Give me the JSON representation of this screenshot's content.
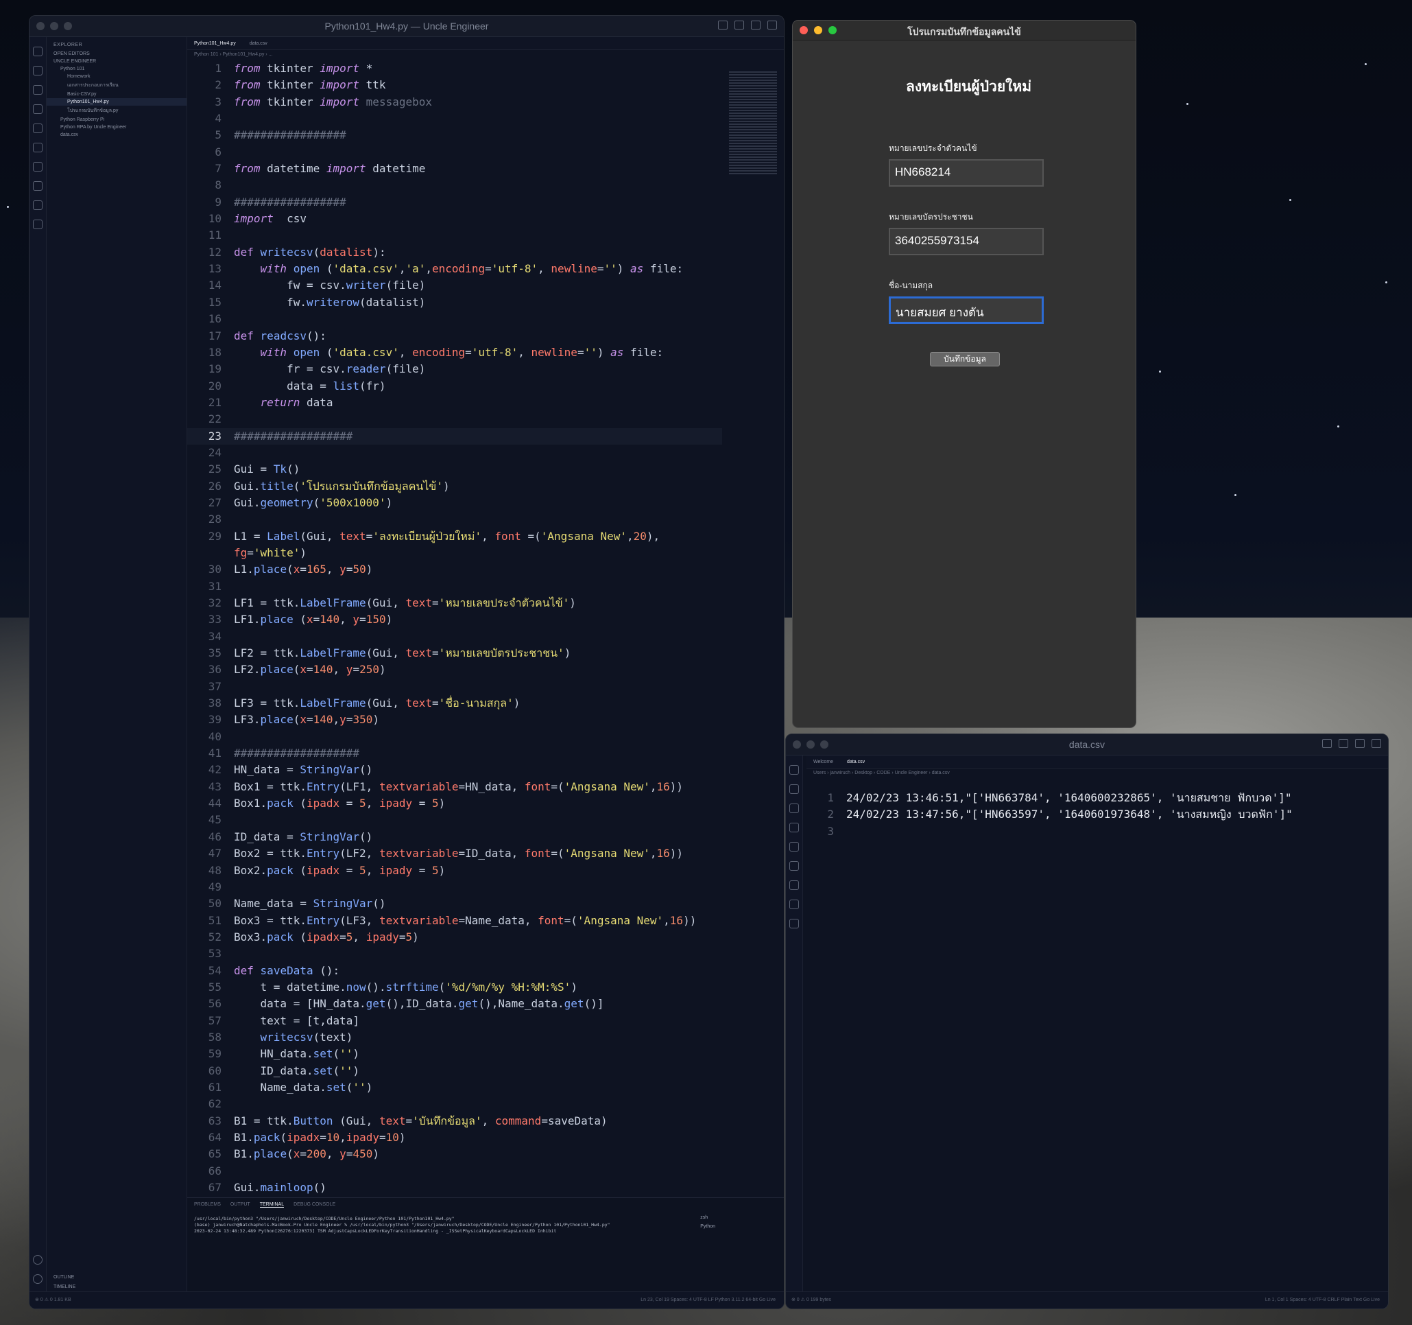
{
  "editor1": {
    "window_title": "Python101_Hw4.py — Uncle Engineer",
    "explorer_title": "EXPLORER",
    "sidebar": [
      {
        "label": "OPEN EDITORS"
      },
      {
        "label": "UNCLE ENGINEER"
      },
      {
        "label": "Python 101"
      },
      {
        "label": "Homework"
      },
      {
        "label": "เอกสารประกอบการเรียน"
      },
      {
        "label": "Basic-CSV.py"
      },
      {
        "label": "Python101_Hw4.py"
      },
      {
        "label": "โปรแกรมบันทึกข้อมูล.py"
      },
      {
        "label": "Python Raspberry Pi"
      },
      {
        "label": "Python RPA by Uncle Engineer"
      },
      {
        "label": "data.csv"
      }
    ],
    "outline": "OUTLINE",
    "timeline": "TIMELINE",
    "tabs": [
      {
        "label": "Python101_Hw4.py"
      },
      {
        "label": "data.csv"
      }
    ],
    "breadcrumb": "Python 101 › Python101_Hw4.py › ...",
    "panel_tabs": [
      "PROBLEMS",
      "OUTPUT",
      "TERMINAL",
      "DEBUG CONSOLE"
    ],
    "terminal_lines": [
      "/usr/local/bin/python3 \"/Users/janwiruch/Desktop/CODE/Uncle Engineer/Python 101/Python101_Hw4.py\"",
      "(base) janwiruch@Natchaphols-MacBook-Pro Uncle Engineer % /usr/local/bin/python3 \"/Users/janwiruch/Desktop/CODE/Uncle Engineer/Python 101/Python101_Hw4.py\"",
      "2023-02-24 13:48:32.489 Python[26276:1220373] TSM AdjustCapsLockLEDForKeyTransitionHandling - _ISSetPhysicalKeyboardCapsLockLED Inhibit"
    ],
    "terminal_list": [
      "zsh",
      "Python"
    ],
    "status_left": "⊗ 0 ⚠ 0    1.81 KB",
    "status_right": "Ln 23, Col 19   Spaces: 4   UTF-8   LF   Python   3.11.2 64-bit   Go Live"
  },
  "tk_app": {
    "window_title": "โปรแกรมบันทึกข้อมูลคนไข้",
    "heading": "ลงทะเบียนผู้ป่วยใหม่",
    "fields": [
      {
        "label": "หมายเลขประจำตัวคนไข้",
        "value": "HN668214"
      },
      {
        "label": "หมายเลขบัตรประชาชน",
        "value": "3640255973154"
      },
      {
        "label": "ชื่อ-นามสกุล",
        "value": "นายสมยศ ยางตัน"
      }
    ],
    "save_button": "บันทึกข้อมูล",
    "traffic_colors": [
      "#ff5f57",
      "#febc2e",
      "#28c840"
    ]
  },
  "editor2": {
    "window_title": "data.csv",
    "tabs": [
      {
        "label": "Welcome"
      },
      {
        "label": "data.csv"
      }
    ],
    "breadcrumb": "Users › janwiruch › Desktop › CODE › Uncle Engineer › data.csv",
    "lines": [
      "24/02/23 13:46:51,\"['HN663784', '1640600232865', 'นายสมชาย ฟักบวด']\"",
      "24/02/23 13:47:56,\"['HN663597', '1640601973648', 'นางสมหญิง บวดฟัก']\"",
      ""
    ],
    "status_left": "⊗ 0 ⚠ 0    199 bytes",
    "status_right": "Ln 1, Col 1   Spaces: 4   UTF-8   CRLF   Plain Text   Go Live"
  }
}
